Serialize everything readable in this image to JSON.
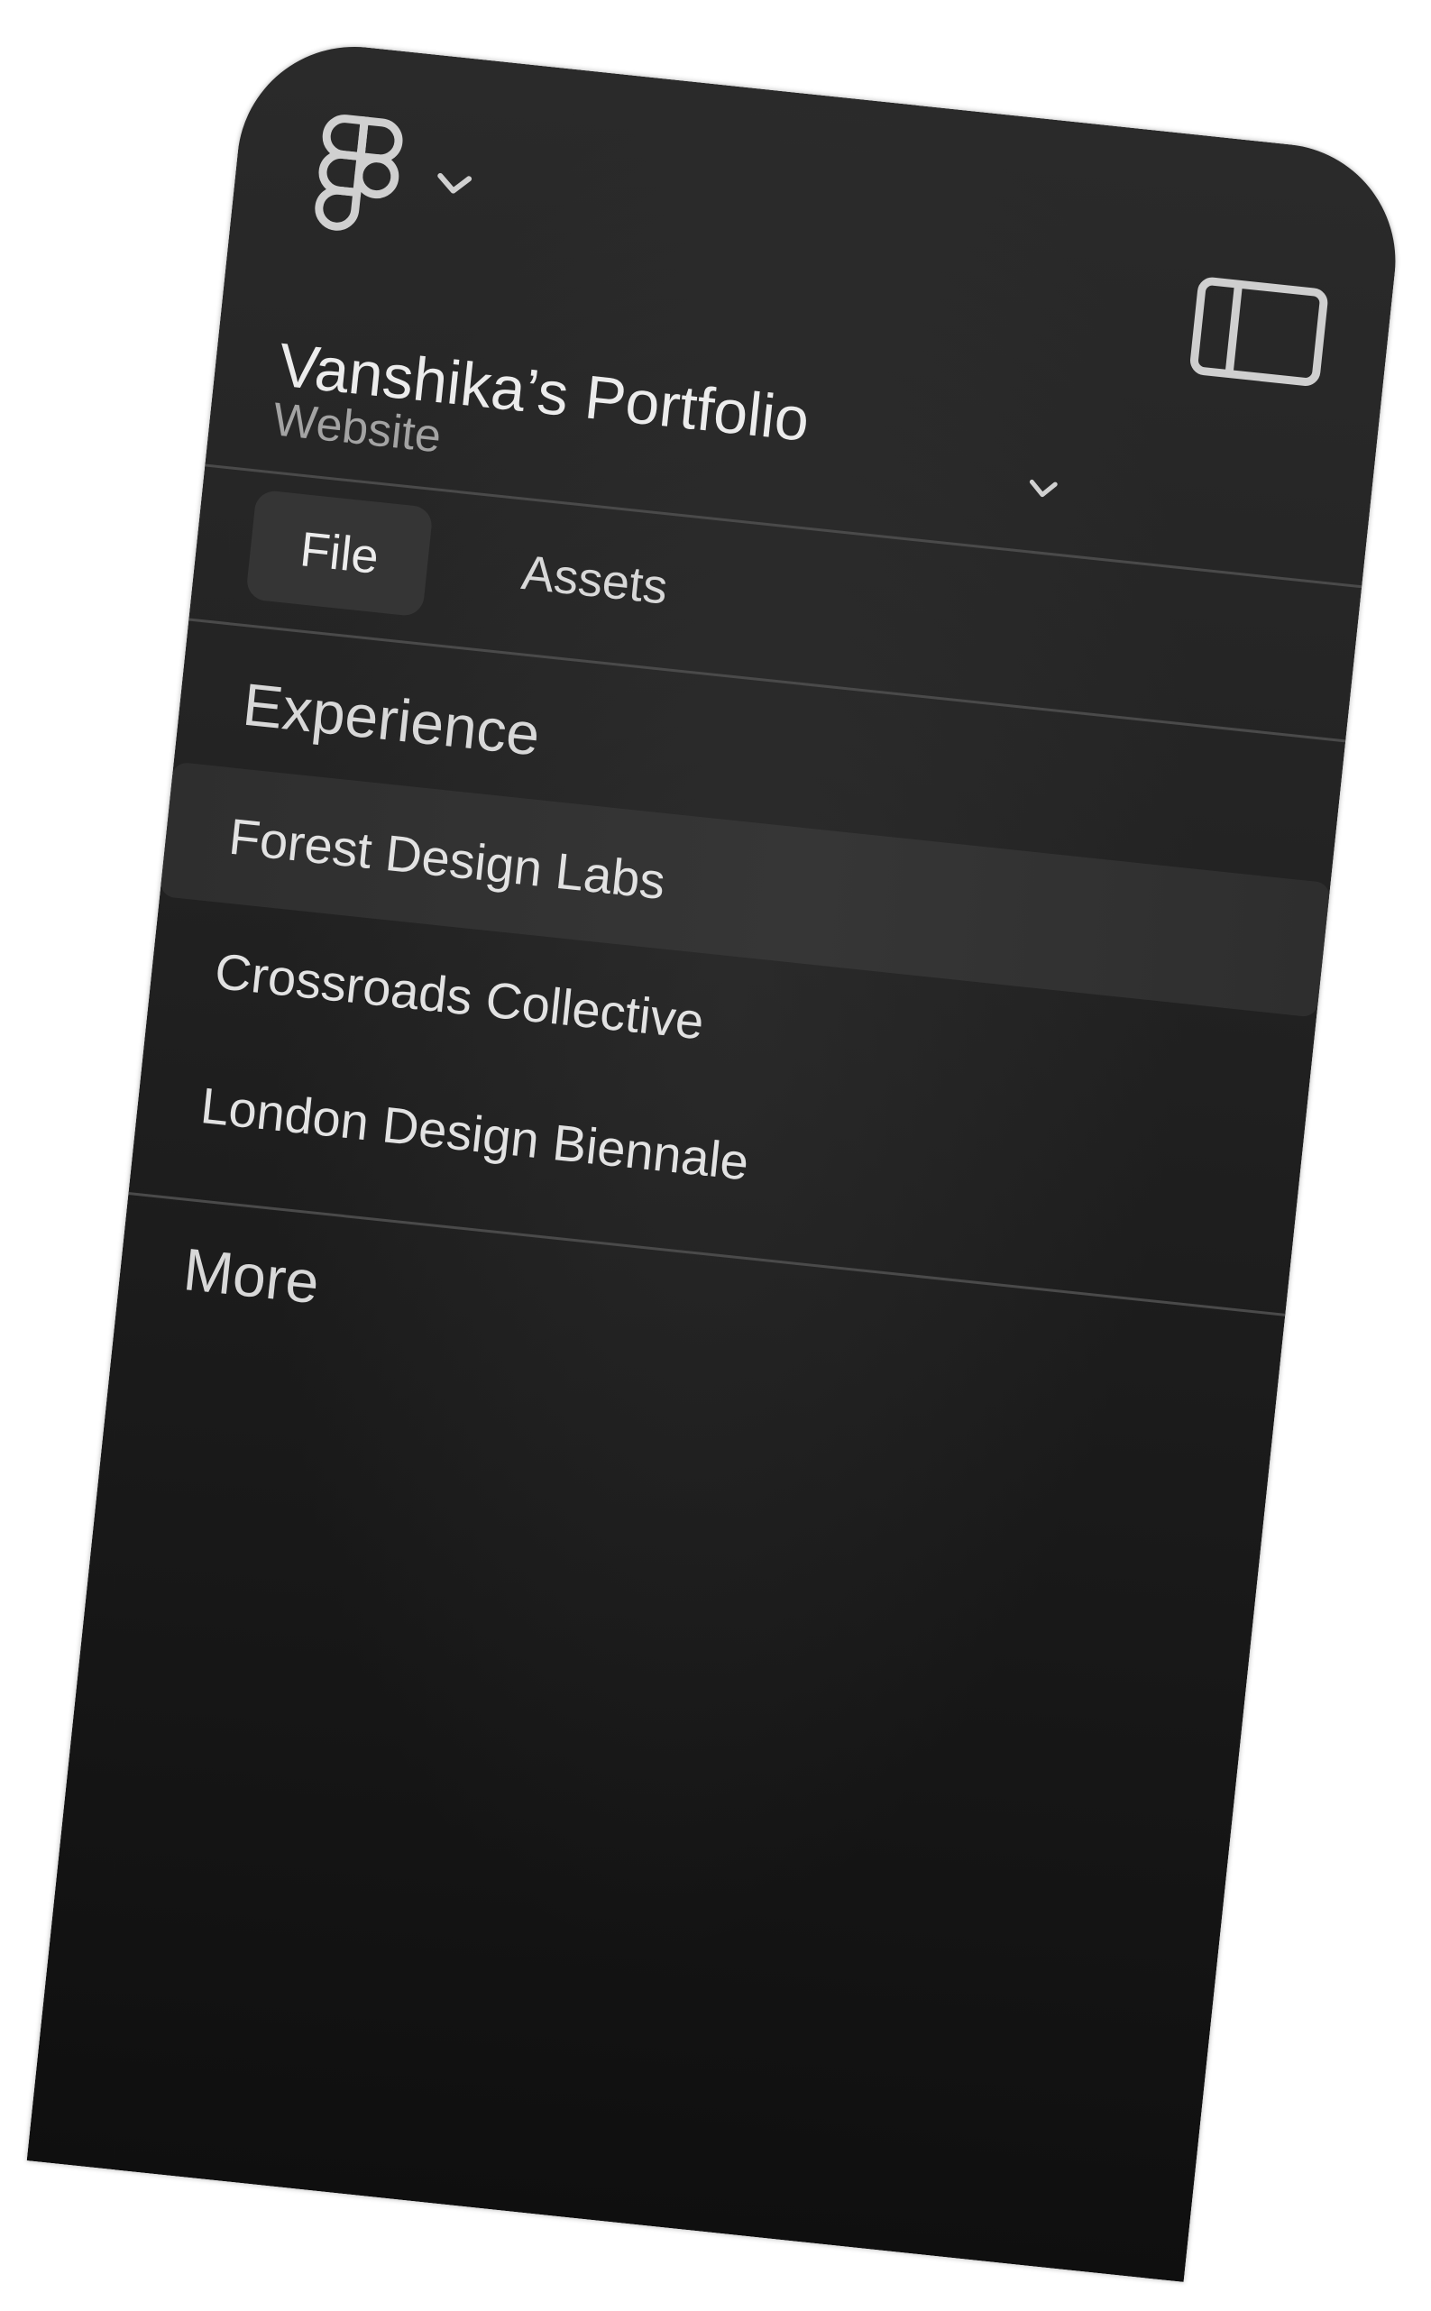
{
  "app": {
    "menu_icon": "figma-logo-icon",
    "menu_chevron": "chevron-down-icon",
    "layout_toggle_icon": "sidebar-layout-icon"
  },
  "file": {
    "name": "Vanshika’s Portfolio",
    "subtitle": "Website",
    "chevron": "chevron-down-icon"
  },
  "tabs": [
    {
      "label": "File",
      "active": true
    },
    {
      "label": "Assets",
      "active": false
    }
  ],
  "sections": {
    "experience": {
      "title": "Experience",
      "items": [
        {
          "label": "Forest Design Labs",
          "selected": true
        },
        {
          "label": "Crossroads Collective",
          "selected": false
        },
        {
          "label": "London Design Biennale",
          "selected": false
        }
      ]
    },
    "more": {
      "title": "More"
    }
  },
  "colors": {
    "panel_background": "#242424",
    "selected_row": "#353535",
    "divider": "#4a4a4a",
    "text_primary": "#ececec",
    "text_secondary": "#a3a3a3"
  }
}
